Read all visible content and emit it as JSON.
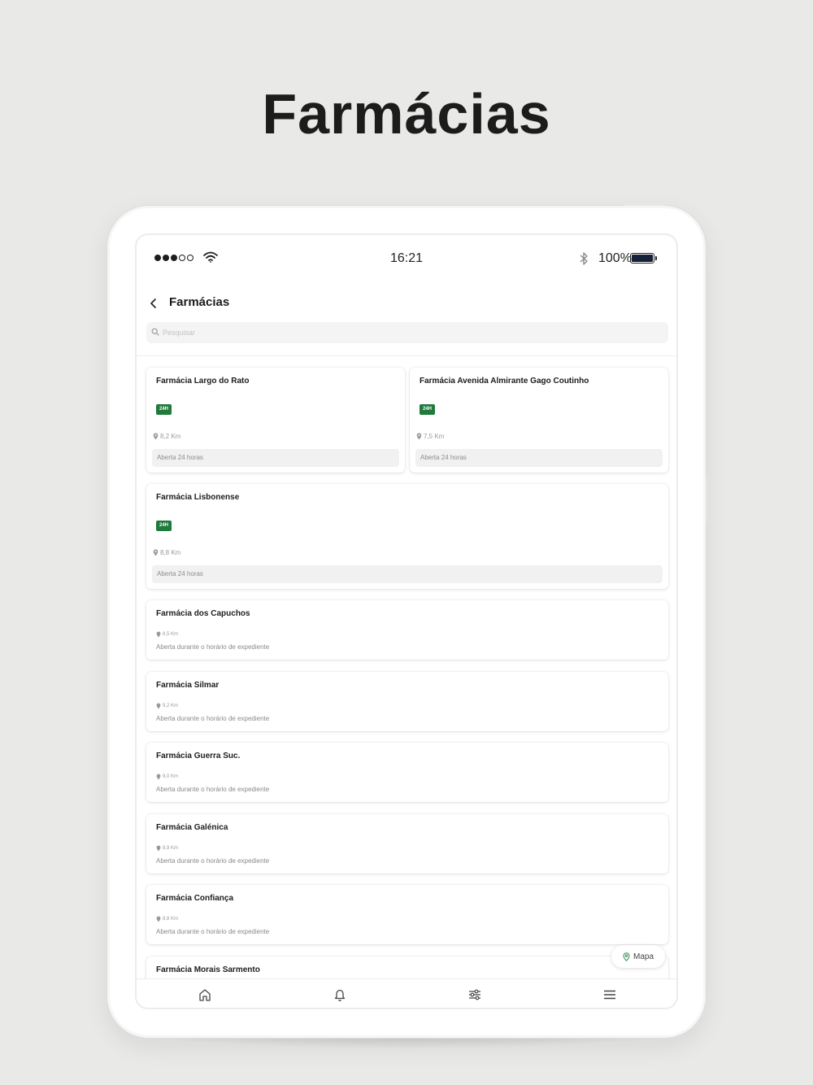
{
  "headline": "Farmácias",
  "status_bar": {
    "time": "16:21",
    "battery_percent": "100%",
    "signal_bars_filled": 3,
    "signal_bars_total": 5
  },
  "header": {
    "title": "Farmácias",
    "back_icon": "chevron-left-icon"
  },
  "search": {
    "placeholder": "Pesquisar",
    "value": ""
  },
  "pharmacies_24h": [
    {
      "name": "Farmácia Largo do Rato",
      "badge": "24H",
      "distance": "8,2 Km",
      "hours": "Aberta 24 horas"
    },
    {
      "name": "Farmácia Avenida Almirante Gago Coutinho",
      "badge": "24H",
      "distance": "7,5 Km",
      "hours": "Aberta 24 horas"
    },
    {
      "name": "Farmácia Lisbonense",
      "badge": "24H",
      "distance": "8,8 Km",
      "hours": "Aberta 24 horas"
    }
  ],
  "pharmacies": [
    {
      "name": "Farmácia dos Capuchos",
      "distance": "8,5 Km",
      "hours": "Aberta durante o horário de expediente"
    },
    {
      "name": "Farmácia Silmar",
      "distance": "9,2 Km",
      "hours": "Aberta durante o horário de expediente"
    },
    {
      "name": "Farmácia Guerra Suc.",
      "distance": "9,0 Km",
      "hours": "Aberta durante o horário de expediente"
    },
    {
      "name": "Farmácia Galénica",
      "distance": "8,9 Km",
      "hours": "Aberta durante o horário de expediente"
    },
    {
      "name": "Farmácia Confiança",
      "distance": "8,8 Km",
      "hours": "Aberta durante o horário de expediente"
    },
    {
      "name": "Farmácia Morais Sarmento",
      "distance": "",
      "hours": ""
    }
  ],
  "map_button": {
    "label": "Mapa",
    "icon": "map-pin-icon"
  },
  "bottom_nav": [
    {
      "icon": "home-icon"
    },
    {
      "icon": "bell-icon"
    },
    {
      "icon": "sliders-icon"
    },
    {
      "icon": "menu-icon"
    }
  ],
  "colors": {
    "background": "#e9e9e7",
    "badge_green": "#1f7a3b",
    "text_dark": "#1b1b1b",
    "text_muted": "#9a9a9a"
  }
}
